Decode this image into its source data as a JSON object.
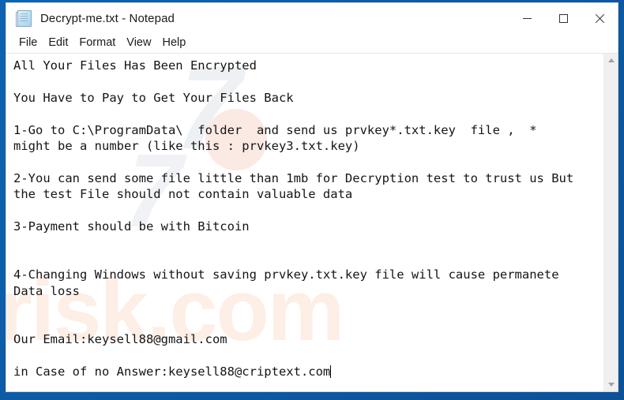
{
  "window": {
    "title": "Decrypt-me.txt - Notepad",
    "icon": "notepad-icon",
    "controls": {
      "minimize": "minimize-icon",
      "maximize": "maximize-icon",
      "close": "close-icon"
    }
  },
  "menu": {
    "items": [
      "File",
      "Edit",
      "Format",
      "View",
      "Help"
    ]
  },
  "document": {
    "lines": [
      "All Your Files Has Been Encrypted",
      "",
      "You Have to Pay to Get Your Files Back",
      "",
      "1-Go to C:\\ProgramData\\  folder  and send us prvkey*.txt.key  file ,  *",
      "might be a number (like this : prvkey3.txt.key)",
      "",
      "2-You can send some file little than 1mb for Decryption test to trust us But",
      "the test File should not contain valuable data",
      "",
      "3-Payment should be with Bitcoin",
      "",
      "",
      "4-Changing Windows without saving prvkey.txt.key file will cause permanete",
      "Data loss",
      "",
      "",
      "Our Email:keysell88@gmail.com",
      "",
      "in Case of no Answer:keysell88@criptext.com"
    ],
    "caret_visible": true
  },
  "scrollbar": {
    "up_arrow": "scroll-up-arrow",
    "down_arrow": "scroll-down-arrow"
  },
  "watermarks": {
    "top": "7",
    "middle": "7",
    "bottom": "risk.com"
  },
  "colors": {
    "frame_blue": "#0d5ca8",
    "window_white": "#ffffff",
    "text": "#151515",
    "scrollbar_track": "#f0f0f0"
  }
}
